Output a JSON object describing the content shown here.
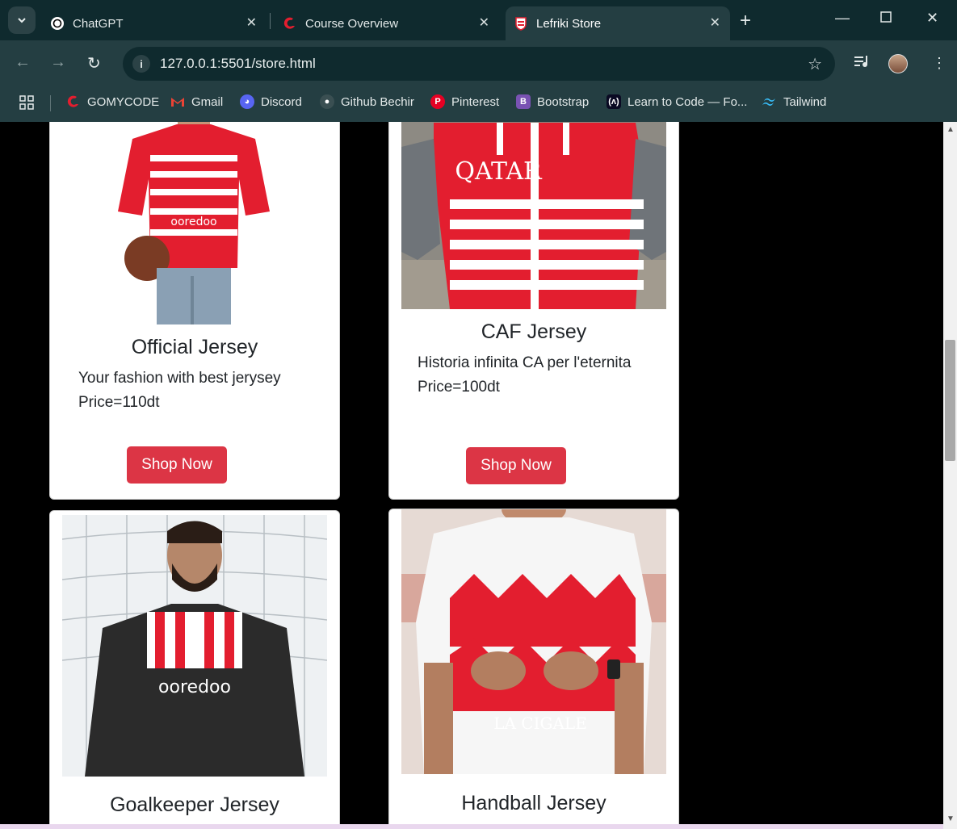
{
  "browser": {
    "tabs": [
      {
        "title": "ChatGPT"
      },
      {
        "title": "Course Overview"
      },
      {
        "title": "Lefriki Store"
      }
    ],
    "url": "127.0.0.1:5501/store.html",
    "bookmarks": [
      {
        "label": "GOMYCODE"
      },
      {
        "label": "Gmail"
      },
      {
        "label": "Discord"
      },
      {
        "label": "Github Bechir"
      },
      {
        "label": "Pinterest"
      },
      {
        "label": "Bootstrap"
      },
      {
        "label": "Learn to Code — Fo..."
      },
      {
        "label": "Tailwind"
      }
    ]
  },
  "products": [
    {
      "title": "Official Jersey",
      "description": "Your fashion with best jerysey",
      "price": "Price=110dt",
      "button": "Shop Now"
    },
    {
      "title": "CAF Jersey",
      "description": "Historia infinita CA per l'eternita",
      "price": "Price=100dt",
      "button": "Shop Now"
    },
    {
      "title": "Goalkeeper Jersey"
    },
    {
      "title": "Handball Jersey"
    }
  ],
  "colors": {
    "button": "#dc3545",
    "accent_red": "#e31e2f"
  }
}
